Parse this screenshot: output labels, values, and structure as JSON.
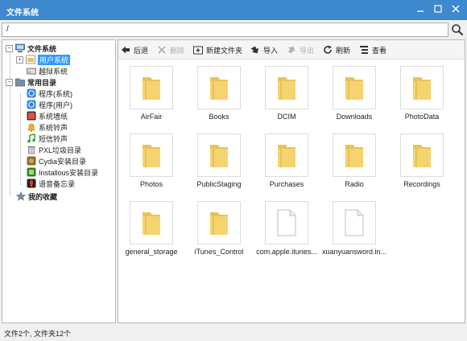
{
  "window": {
    "title": "文件系统"
  },
  "path": {
    "value": "/"
  },
  "toolbar": {
    "back": "后退",
    "delete": "删除",
    "new_folder": "新建文件夹",
    "import": "导入",
    "export": "导出",
    "refresh": "刷新",
    "view": "查看"
  },
  "sidebar": {
    "filesystem": "文件系统",
    "user_system": "用户系统",
    "jail_system": "越狱系统",
    "common_dirs": "常用目录",
    "apps_system": "程序(系统)",
    "apps_user": "程序(用户)",
    "wallpaper": "系统墙纸",
    "ringtone": "系统铃声",
    "sms_tone": "短信铃声",
    "pxl": "PXL垃圾目录",
    "cydia": "Cydia安装目录",
    "installous": "Installous安装目录",
    "voice_memo": "语音备忘录",
    "favorites": "我的收藏"
  },
  "files": [
    {
      "name": "AirFair",
      "type": "folder"
    },
    {
      "name": "Books",
      "type": "folder"
    },
    {
      "name": "DCIM",
      "type": "folder"
    },
    {
      "name": "Downloads",
      "type": "folder"
    },
    {
      "name": "PhotoData",
      "type": "folder"
    },
    {
      "name": "Photos",
      "type": "folder"
    },
    {
      "name": "PublicStaging",
      "type": "folder"
    },
    {
      "name": "Purchases",
      "type": "folder"
    },
    {
      "name": "Radio",
      "type": "folder"
    },
    {
      "name": "Recordings",
      "type": "folder"
    },
    {
      "name": "general_storage",
      "type": "folder"
    },
    {
      "name": "iTunes_Control",
      "type": "folder"
    },
    {
      "name": "com.apple.itunes...",
      "type": "file"
    },
    {
      "name": "xuanyuansword.in...",
      "type": "file"
    }
  ],
  "status": {
    "text": "文件2个, 文件夹12个"
  },
  "colors": {
    "titlebar": "#3e88cd",
    "folder": "#f5d470",
    "selection": "#3399ff"
  }
}
